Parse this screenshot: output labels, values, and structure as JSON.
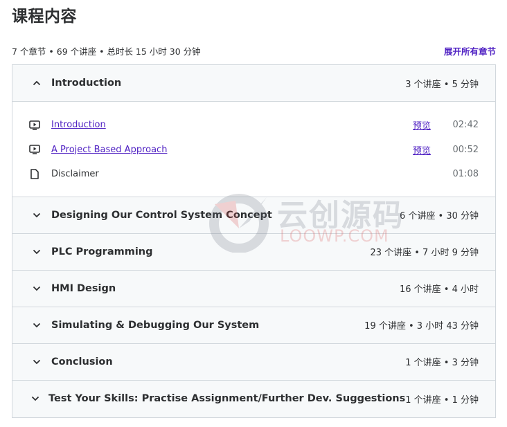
{
  "page": {
    "title": "课程内容",
    "summary": "7 个章节 • 69 个讲座 • 总时长 15 小时 30 分钟",
    "expand_all_label": "展开所有章节"
  },
  "sections": [
    {
      "title": "Introduction",
      "meta": "3 个讲座 • 5 分钟",
      "expanded": true,
      "icon": "chevron-up-icon",
      "lectures": [
        {
          "title": "Introduction",
          "type": "video",
          "icon": "video-icon",
          "preview_label": "预览",
          "duration": "02:42"
        },
        {
          "title": "A Project Based Approach",
          "type": "video",
          "icon": "video-icon",
          "preview_label": "预览",
          "duration": "00:52"
        },
        {
          "title": "Disclaimer",
          "type": "article",
          "icon": "file-icon",
          "preview_label": null,
          "duration": "01:08"
        }
      ]
    },
    {
      "title": "Designing Our Control System Concept",
      "meta": "6 个讲座 • 30 分钟",
      "expanded": false,
      "icon": "chevron-down-icon"
    },
    {
      "title": "PLC Programming",
      "meta": "23 个讲座 • 7 小时 9 分钟",
      "expanded": false,
      "icon": "chevron-down-icon"
    },
    {
      "title": "HMI Design",
      "meta": "16 个讲座 • 4 小时",
      "expanded": false,
      "icon": "chevron-down-icon"
    },
    {
      "title": "Simulating & Debugging Our System",
      "meta": "19 个讲座 • 3 小时 43 分钟",
      "expanded": false,
      "icon": "chevron-down-icon"
    },
    {
      "title": "Conclusion",
      "meta": "1 个讲座 • 3 分钟",
      "expanded": false,
      "icon": "chevron-down-icon"
    },
    {
      "title": "Test Your Skills: Practise Assignment/Further Dev. Suggestions",
      "meta": "1 个讲座 • 1 分钟",
      "expanded": false,
      "icon": "chevron-down-icon"
    }
  ],
  "watermark": {
    "text_cn": "云创源码",
    "text_en": "LOOWP.COM"
  },
  "colors": {
    "link": "#5022c3",
    "text": "#2d2f31",
    "muted": "#6a6f73",
    "section_bg": "#f7f9fa",
    "border": "#d1d7dc"
  }
}
